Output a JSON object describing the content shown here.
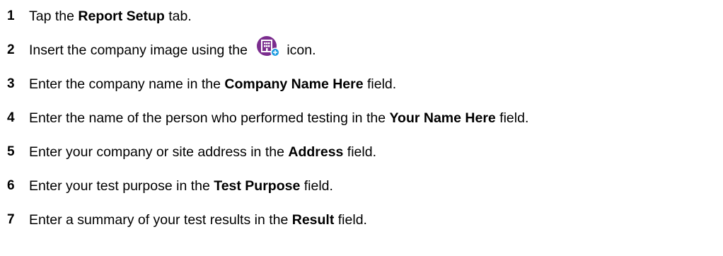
{
  "steps": [
    {
      "number": "1",
      "before": "Tap the ",
      "bold": "Report Setup",
      "after": " tab."
    },
    {
      "number": "2",
      "before": "Insert the company image using the ",
      "icon": "building-add-icon",
      "after": "icon."
    },
    {
      "number": "3",
      "before": "Enter the company name in the ",
      "bold": "Company Name Here",
      "after": " field."
    },
    {
      "number": "4",
      "before": "Enter the name of the person who performed testing in the ",
      "bold": "Your Name Here",
      "after": " field."
    },
    {
      "number": "5",
      "before": "Enter your company or site address in the ",
      "bold": "Address",
      "after": " field."
    },
    {
      "number": "6",
      "before": "Enter your test purpose in the ",
      "bold": "Test Purpose",
      "after": " field."
    },
    {
      "number": "7",
      "before": "Enter a summary of your test results in the ",
      "bold": "Result",
      "after": " field."
    }
  ],
  "colors": {
    "icon_circle": "#7b2d8e",
    "icon_badge": "#1a9be0",
    "text": "#000000"
  }
}
